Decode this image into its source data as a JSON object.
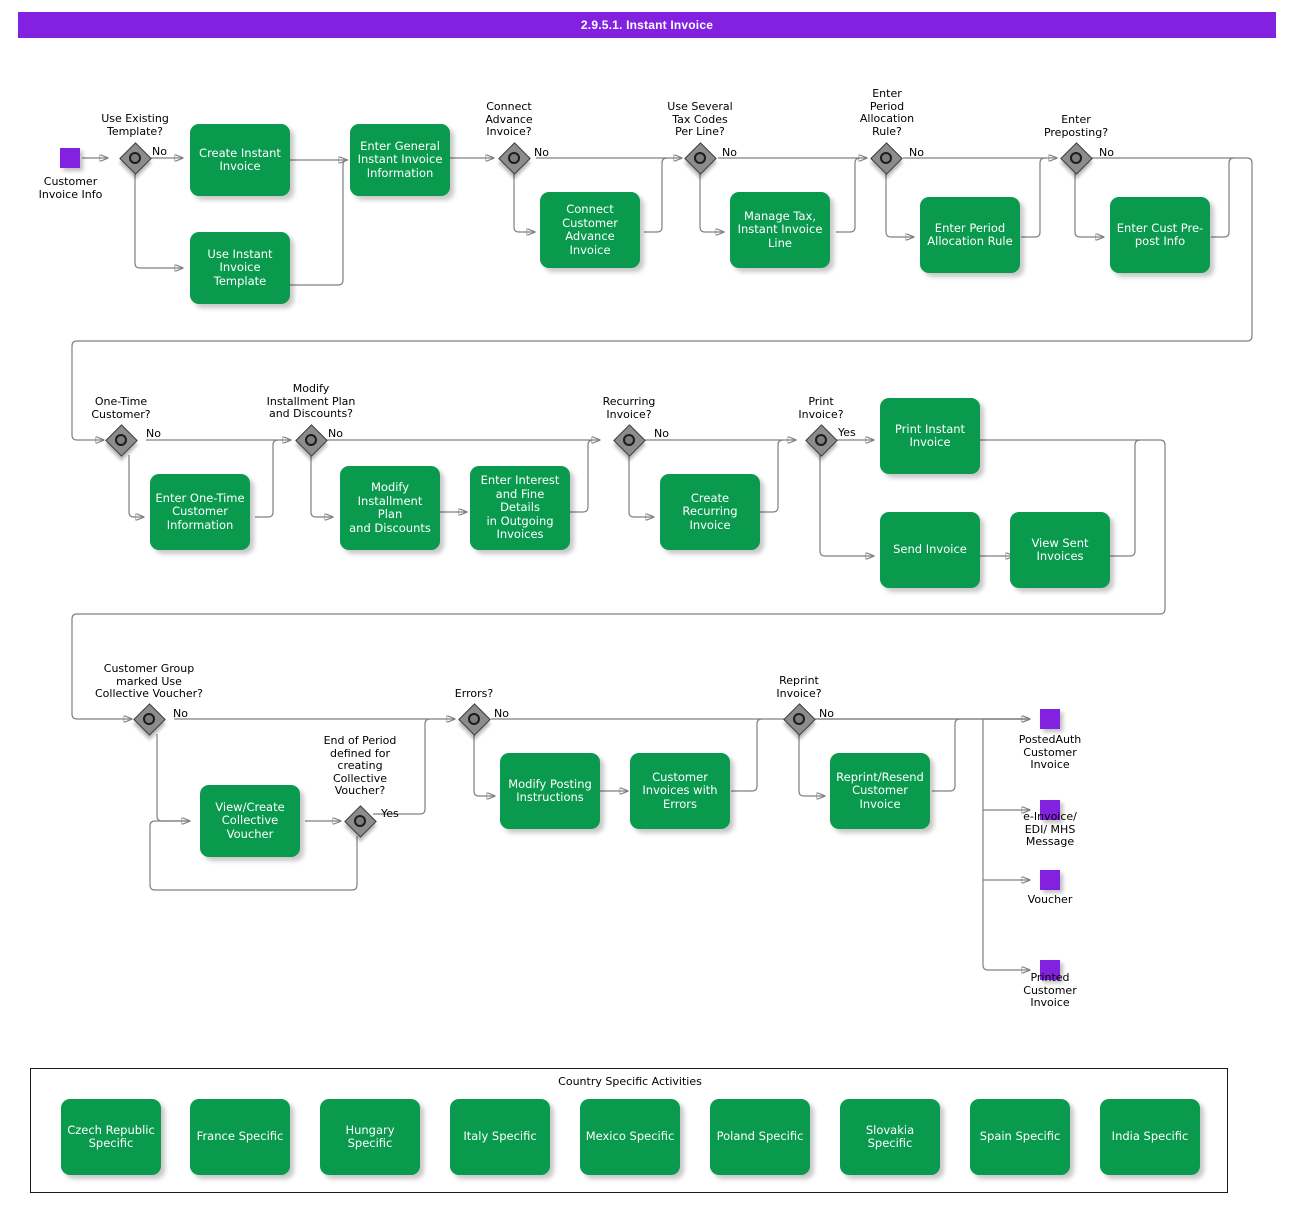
{
  "header": {
    "title": "2.9.5.1. Instant Invoice",
    "bar_color": "#8222e0"
  },
  "colors": {
    "task_fill": "#0a9a4e",
    "task_text": "#ffffff",
    "event_fill": "#8222e0",
    "gateway_fill": "#8c8c8c",
    "connector": "#808080"
  },
  "events": {
    "start": {
      "label": "Customer\nInvoice Info",
      "icon": "start-event-square"
    },
    "end_posted_auth": {
      "label": "PostedAuth\nCustomer\nInvoice",
      "icon": "end-event-square"
    },
    "end_einvoice": {
      "label": "e-Invoice/\nEDI/ MHS\nMessage",
      "icon": "end-event-square"
    },
    "end_voucher": {
      "label": "Voucher",
      "icon": "end-event-square"
    },
    "end_printed": {
      "label": "Printed\nCustomer\nInvoice",
      "icon": "end-event-square"
    }
  },
  "gateways": [
    {
      "id": "use-existing-template",
      "label": "Use Existing\nTemplate?",
      "branch": "No"
    },
    {
      "id": "connect-advance-invoice",
      "label": "Connect\nAdvance\nInvoice?",
      "branch": "No"
    },
    {
      "id": "use-several-tax-codes",
      "label": "Use Several\nTax Codes\nPer Line?",
      "branch": "No"
    },
    {
      "id": "enter-period-allocation",
      "label": "Enter\nPeriod\nAllocation\nRule?",
      "branch": "No"
    },
    {
      "id": "enter-preposting",
      "label": "Enter\nPreposting?",
      "branch": "No"
    },
    {
      "id": "one-time-customer",
      "label": "One-Time\nCustomer?",
      "branch": "No"
    },
    {
      "id": "modify-installment-plan",
      "label": "Modify\nInstallment Plan\nand Discounts?",
      "branch": "No"
    },
    {
      "id": "recurring-invoice",
      "label": "Recurring\nInvoice?",
      "branch": "No"
    },
    {
      "id": "print-invoice",
      "label": "Print\nInvoice?",
      "branch": "Yes"
    },
    {
      "id": "customer-group-collective",
      "label": "Customer Group\nmarked Use\nCollective Voucher?",
      "branch": "No"
    },
    {
      "id": "end-of-period-collective",
      "label": "End of Period\ndefined for\ncreating\nCollective\nVoucher?",
      "branch": "Yes"
    },
    {
      "id": "errors",
      "label": "Errors?",
      "branch": "No"
    },
    {
      "id": "reprint-invoice",
      "label": "Reprint\nInvoice?",
      "branch": "No"
    }
  ],
  "tasks": [
    {
      "id": "create-instant-invoice",
      "label": "Create Instant\nInvoice"
    },
    {
      "id": "use-instant-invoice-template",
      "label": "Use Instant\nInvoice\nTemplate"
    },
    {
      "id": "enter-general-info",
      "label": "Enter General\nInstant Invoice\nInformation"
    },
    {
      "id": "connect-customer-advance",
      "label": "Connect\nCustomer\nAdvance Invoice"
    },
    {
      "id": "manage-tax-line",
      "label": "Manage Tax,\nInstant Invoice\nLine"
    },
    {
      "id": "enter-period-allocation-rule",
      "label": "Enter Period\nAllocation Rule"
    },
    {
      "id": "enter-cust-prepost-info",
      "label": "Enter Cust Pre-\npost Info"
    },
    {
      "id": "enter-one-time-customer-info",
      "label": "Enter One-Time\nCustomer\nInformation"
    },
    {
      "id": "modify-installment-discounts",
      "label": "Modify\nInstallment Plan\nand Discounts"
    },
    {
      "id": "enter-interest-fine-details",
      "label": "Enter Interest\nand Fine Details\nin Outgoing\nInvoices"
    },
    {
      "id": "create-recurring-invoice",
      "label": "Create\nRecurring\nInvoice"
    },
    {
      "id": "print-instant-invoice",
      "label": "Print Instant\nInvoice"
    },
    {
      "id": "send-invoice",
      "label": "Send Invoice"
    },
    {
      "id": "view-sent-invoices",
      "label": "View Sent\nInvoices"
    },
    {
      "id": "view-create-collective-voucher",
      "label": "View/Create\nCollective\nVoucher"
    },
    {
      "id": "modify-posting-instructions",
      "label": "Modify Posting\nInstructions"
    },
    {
      "id": "customer-invoices-with-errors",
      "label": "Customer\nInvoices with\nErrors"
    },
    {
      "id": "reprint-resend-customer-invoice",
      "label": "Reprint/Resend\nCustomer\nInvoice"
    }
  ],
  "country_pool": {
    "title": "Country Specific Activities",
    "items": [
      "Czech Republic\nSpecific",
      "France Specific",
      "Hungary Specific",
      "Italy Specific",
      "Mexico Specific",
      "Poland Specific",
      "Slovakia\nSpecific",
      "Spain Specific",
      "India Specific"
    ]
  }
}
